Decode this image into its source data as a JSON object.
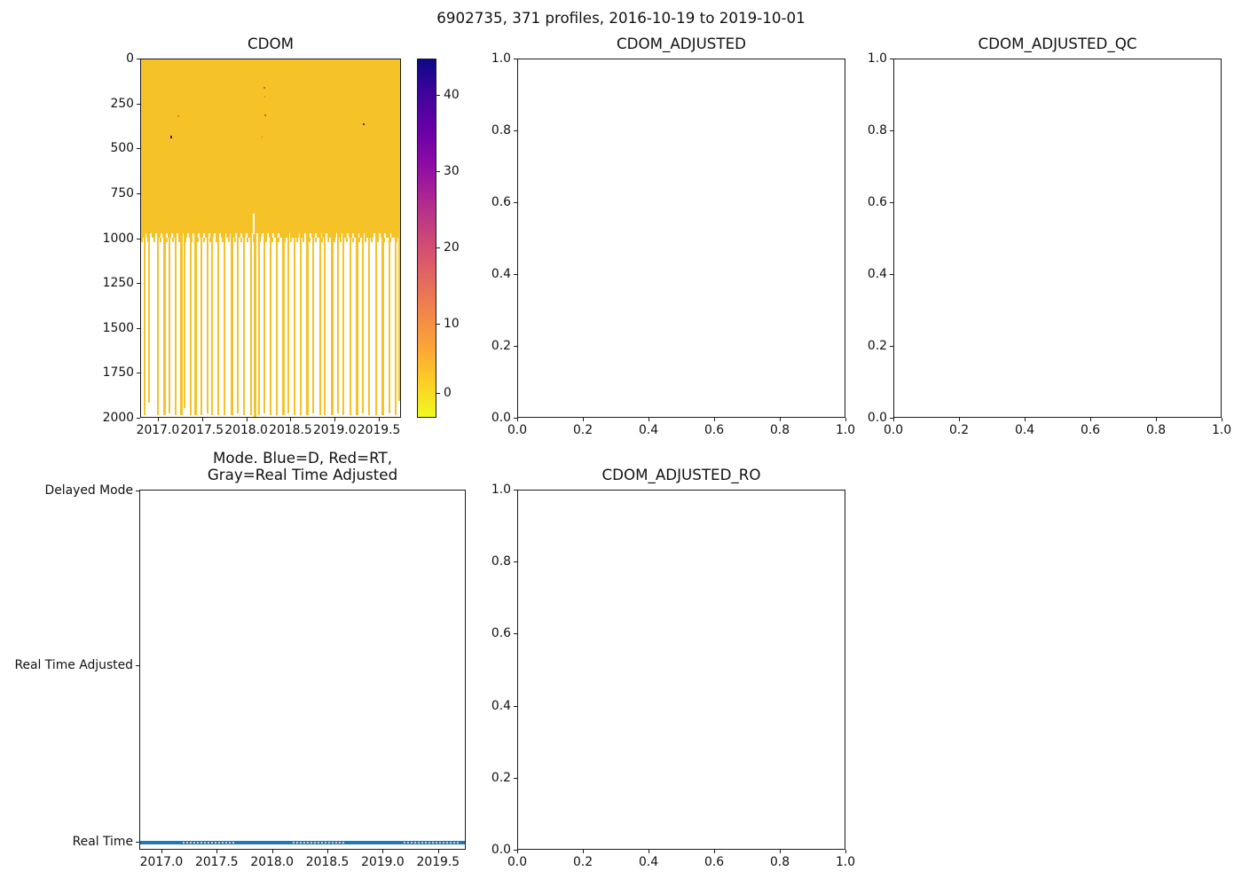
{
  "suptitle": "6902735, 371 profiles, 2016-10-19 to 2019-10-01",
  "chart_data": [
    {
      "id": "cdom",
      "type": "heatmap",
      "title": "CDOM",
      "xlabel": "",
      "ylabel": "",
      "xlim": [
        2016.8,
        2019.75
      ],
      "ylim": [
        2000,
        0
      ],
      "x_ticks": [
        "2017.0",
        "2017.5",
        "2018.0",
        "2018.5",
        "2019.0",
        "2019.5"
      ],
      "x_tick_fracs": [
        0.0678,
        0.2373,
        0.4068,
        0.5763,
        0.7458,
        0.9153
      ],
      "y_ticks": [
        "0",
        "250",
        "500",
        "750",
        "1000",
        "1250",
        "1500",
        "1750",
        "2000"
      ],
      "y_tick_fracs": [
        0,
        0.125,
        0.25,
        0.375,
        0.5,
        0.625,
        0.75,
        0.875,
        1.0
      ],
      "body_color": "#f5c328",
      "solid_region": {
        "top_frac": 0.0,
        "bottom_frac": 0.484,
        "note": "dense CDOM data 0-~970 dbar, value ~0"
      },
      "deep_stripes": [
        [
          0.01,
          2,
          0.99
        ],
        [
          0.028,
          2,
          0.955
        ],
        [
          0.06,
          2,
          0.99
        ],
        [
          0.085,
          3,
          0.99
        ],
        [
          0.105,
          2,
          0.985
        ],
        [
          0.128,
          2,
          0.99
        ],
        [
          0.15,
          3,
          0.99
        ],
        [
          0.163,
          2,
          0.97
        ],
        [
          0.188,
          2,
          0.99
        ],
        [
          0.203,
          3,
          0.99
        ],
        [
          0.228,
          2,
          0.99
        ],
        [
          0.252,
          2,
          0.985
        ],
        [
          0.268,
          2,
          0.99
        ],
        [
          0.292,
          2,
          0.99
        ],
        [
          0.318,
          2,
          0.99
        ],
        [
          0.342,
          3,
          0.99
        ],
        [
          0.368,
          2,
          0.985
        ],
        [
          0.392,
          2,
          0.99
        ],
        [
          0.418,
          2,
          0.99
        ],
        [
          0.432,
          3,
          0.995
        ],
        [
          0.448,
          2,
          0.99
        ],
        [
          0.468,
          2,
          0.985
        ],
        [
          0.492,
          2,
          0.99
        ],
        [
          0.518,
          2,
          0.99
        ],
        [
          0.542,
          3,
          0.99
        ],
        [
          0.562,
          2,
          0.985
        ],
        [
          0.585,
          2,
          0.99
        ],
        [
          0.608,
          2,
          0.99
        ],
        [
          0.632,
          3,
          0.99
        ],
        [
          0.658,
          2,
          0.985
        ],
        [
          0.682,
          2,
          0.99
        ],
        [
          0.702,
          2,
          0.99
        ],
        [
          0.728,
          3,
          0.99
        ],
        [
          0.752,
          2,
          0.985
        ],
        [
          0.772,
          2,
          0.99
        ],
        [
          0.798,
          2,
          0.99
        ],
        [
          0.822,
          3,
          0.99
        ],
        [
          0.848,
          2,
          0.985
        ],
        [
          0.872,
          2,
          0.99
        ],
        [
          0.898,
          2,
          0.99
        ],
        [
          0.922,
          3,
          0.99
        ],
        [
          0.948,
          2,
          0.985
        ],
        [
          0.972,
          2,
          0.99
        ],
        [
          0.988,
          2,
          0.95
        ]
      ],
      "specks": [
        [
          0.112,
          0.212,
          2,
          3,
          "#40125e"
        ],
        [
          0.139,
          0.156,
          2,
          2,
          "#ef7f45"
        ],
        [
          0.469,
          0.077,
          2,
          2,
          "#e05a33"
        ],
        [
          0.473,
          0.101,
          1,
          2,
          "#ef8045"
        ],
        [
          0.473,
          0.153,
          2,
          2,
          "#e0512b"
        ],
        [
          0.463,
          0.212,
          1,
          2,
          "#ef8045"
        ],
        [
          0.85,
          0.178,
          2,
          2,
          "#472a9a"
        ]
      ],
      "notch": {
        "x_frac": 0.429,
        "width": 2,
        "top_frac": 0.43,
        "bottom_frac": 0.487
      },
      "colorbar": {
        "vmin": -3.3,
        "vmax": 45.3,
        "ticks": [
          {
            "label": "40",
            "frac_from_top": 0.101
          },
          {
            "label": "30",
            "frac_from_top": 0.314
          },
          {
            "label": "20",
            "frac_from_top": 0.526
          },
          {
            "label": "10",
            "frac_from_top": 0.738
          },
          {
            "label": "0",
            "frac_from_top": 0.931
          }
        ],
        "colors_bottom_to_top": [
          "#f0f921",
          "#fccd25",
          "#fca338",
          "#f1834b",
          "#e16462",
          "#cc4778",
          "#b12a90",
          "#8f0da4",
          "#6a00a8",
          "#41049d",
          "#0d0887"
        ]
      }
    },
    {
      "id": "cdom_adjusted",
      "type": "empty",
      "title": "CDOM_ADJUSTED",
      "xlim": [
        0.0,
        1.0
      ],
      "ylim": [
        0.0,
        1.0
      ],
      "x_ticks": [
        "0.0",
        "0.2",
        "0.4",
        "0.6",
        "0.8",
        "1.0"
      ],
      "x_tick_fracs": [
        0,
        0.2,
        0.4,
        0.6,
        0.8,
        1.0
      ],
      "y_ticks": [
        "1.0",
        "0.8",
        "0.6",
        "0.4",
        "0.2",
        "0.0"
      ],
      "y_tick_fracs": [
        0,
        0.2,
        0.4,
        0.6,
        0.8,
        1.0
      ]
    },
    {
      "id": "cdom_adjusted_qc",
      "type": "empty",
      "title": "CDOM_ADJUSTED_QC",
      "xlim": [
        0.0,
        1.0
      ],
      "ylim": [
        0.0,
        1.0
      ],
      "x_ticks": [
        "0.0",
        "0.2",
        "0.4",
        "0.6",
        "0.8",
        "1.0"
      ],
      "x_tick_fracs": [
        0,
        0.2,
        0.4,
        0.6,
        0.8,
        1.0
      ],
      "y_ticks": [
        "1.0",
        "0.8",
        "0.6",
        "0.4",
        "0.2",
        "0.0"
      ],
      "y_tick_fracs": [
        0,
        0.2,
        0.4,
        0.6,
        0.8,
        1.0
      ]
    },
    {
      "id": "mode",
      "type": "line-categorical",
      "title_lines": [
        "Mode. Blue=D, Red=RT,",
        "Gray=Real Time Adjusted"
      ],
      "xlim": [
        2016.8,
        2019.75
      ],
      "x_ticks": [
        "2017.0",
        "2017.5",
        "2018.0",
        "2018.5",
        "2019.0",
        "2019.5"
      ],
      "x_tick_fracs": [
        0.0678,
        0.2373,
        0.4068,
        0.5763,
        0.7458,
        0.9153
      ],
      "y_ticks": [
        "Delayed Mode",
        "Real Time Adjusted",
        "Real Time"
      ],
      "y_tick_fracs": [
        0.002,
        0.488,
        0.978
      ],
      "series": [
        {
          "name": "Real Time profiles",
          "color": "#1f77b4",
          "y_category": "Real Time",
          "y_frac": 0.978,
          "x_start_frac": 0.0,
          "x_end_frac": 1.0,
          "thickness": 4
        }
      ],
      "gray_overlay_color": "#c9ced6",
      "gray_overlay_segments": [
        [
          0.13,
          0.29
        ],
        [
          0.467,
          0.63
        ],
        [
          0.807,
          0.98
        ]
      ]
    },
    {
      "id": "cdom_adjusted_ro",
      "type": "empty",
      "title": "CDOM_ADJUSTED_RO",
      "xlim": [
        0.0,
        1.0
      ],
      "ylim": [
        0.0,
        1.0
      ],
      "x_ticks": [
        "0.0",
        "0.2",
        "0.4",
        "0.6",
        "0.8",
        "1.0"
      ],
      "x_tick_fracs": [
        0,
        0.2,
        0.4,
        0.6,
        0.8,
        1.0
      ],
      "y_ticks": [
        "1.0",
        "0.8",
        "0.6",
        "0.4",
        "0.2",
        "0.0"
      ],
      "y_tick_fracs": [
        0,
        0.2,
        0.4,
        0.6,
        0.8,
        1.0
      ]
    }
  ]
}
